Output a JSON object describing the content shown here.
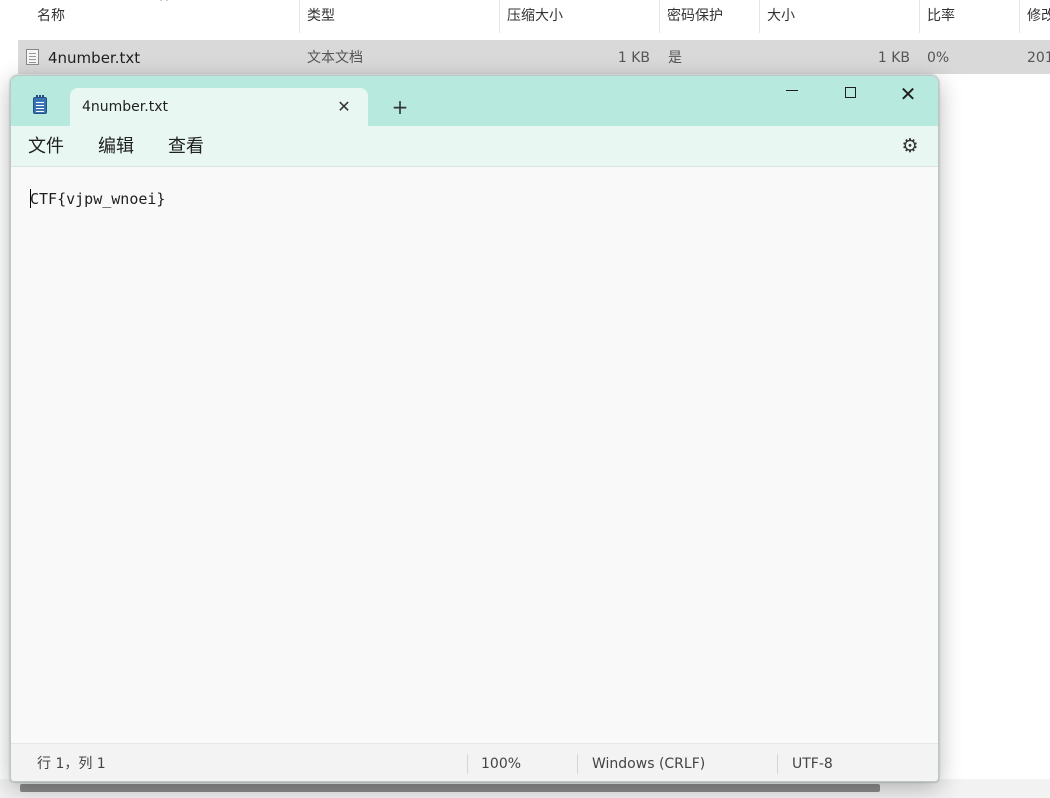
{
  "archive": {
    "sort_indicator": "^",
    "columns": [
      "名称",
      "类型",
      "压缩大小",
      "密码保护",
      "大小",
      "比率",
      "修改"
    ],
    "row": {
      "name": "4number.txt",
      "type": "文本文档",
      "compressed_size": "1 KB",
      "password": "是",
      "size": "1 KB",
      "ratio": "0%",
      "modified": "201"
    }
  },
  "notepad": {
    "tab_title": "4number.txt",
    "close_tab_glyph": "✕",
    "new_tab_glyph": "+",
    "window_controls": {
      "close_glyph": "✕"
    },
    "menu": [
      "文件",
      "编辑",
      "查看"
    ],
    "settings_icon": "gear-icon",
    "settings_glyph": "⚙",
    "content": "CTF{vjpw_wnoei}",
    "status": {
      "position": "行 1，列 1",
      "zoom": "100%",
      "line_endings": "Windows (CRLF)",
      "encoding": "UTF-8"
    }
  },
  "colors": {
    "titlebar": "#b8e9de",
    "tab_active": "#e9f7f3",
    "editor_bg": "#f9f9f9",
    "archive_selection": "#d9d9d9"
  }
}
